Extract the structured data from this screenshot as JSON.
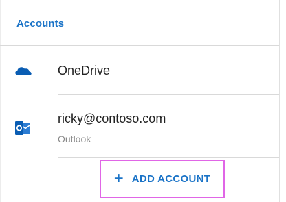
{
  "section": {
    "title": "Accounts"
  },
  "accounts": [
    {
      "name": "OneDrive",
      "icon": "onedrive-cloud-icon"
    },
    {
      "name": "ricky@contoso.com",
      "type": "Outlook",
      "icon": "outlook-icon"
    }
  ],
  "actions": {
    "add_account_label": "ADD ACCOUNT",
    "add_account_icon": "plus-icon"
  },
  "colors": {
    "accent": "#1a73c7",
    "highlight": "#e066e6",
    "outlook_blue": "#0a5db3",
    "subtext": "#888888"
  }
}
